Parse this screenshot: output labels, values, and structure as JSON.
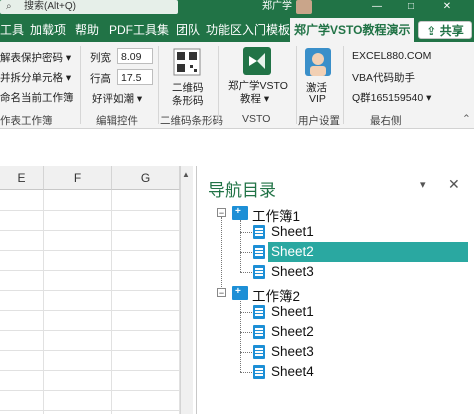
{
  "titlebar": {
    "search_text": "搜索(Alt+Q)",
    "user_name": "郑广学",
    "minimize": "—",
    "restore": "□",
    "close": "✕"
  },
  "tabs": [
    {
      "label": "工具"
    },
    {
      "label": "加载项"
    },
    {
      "label": "帮助"
    },
    {
      "label": "PDF工具集"
    },
    {
      "label": "团队"
    },
    {
      "label": "功能区入门模板"
    },
    {
      "label": "郑广学VSTO教程演示",
      "active": true
    }
  ],
  "share_label": "共享",
  "ribbon": {
    "workbook_tools": {
      "items": [
        "解表保护密码",
        "并拆分单元格",
        "命名当前工作簿"
      ],
      "group_label": "作表工作簿"
    },
    "edit_controls": {
      "col_width_label": "列宽",
      "col_width_value": "8.09",
      "row_height_label": "行高",
      "row_height_value": "17.5",
      "dropdown_label": "好评如潮",
      "group_label": "编辑控件"
    },
    "qr": {
      "button_label_1": "二维码",
      "button_label_2": "条形码",
      "group_label": "二维码条形码"
    },
    "vsto": {
      "button_label_1": "郑广学VSTO",
      "button_label_2": "教程",
      "group_label": "VSTO"
    },
    "user": {
      "button_label_1": "激活",
      "button_label_2": "VIP",
      "group_label": "用户设置"
    },
    "latest": {
      "items": [
        "EXCEL880.COM",
        "VBA代码助手",
        "Q群165159540"
      ],
      "group_label": "最右侧"
    }
  },
  "grid": {
    "columns": [
      "E",
      "F",
      "G"
    ]
  },
  "nav": {
    "title": "导航目录",
    "workbooks": [
      {
        "name": "工作簿1",
        "sheets": [
          "Sheet1",
          "Sheet2",
          "Sheet3"
        ]
      },
      {
        "name": "工作簿2",
        "sheets": [
          "Sheet1",
          "Sheet2",
          "Sheet3",
          "Sheet4"
        ]
      }
    ],
    "selected": "工作簿1/Sheet2"
  },
  "colors": {
    "brand": "#217346",
    "selection": "#2aa8a1",
    "tree_icon": "#1d8fd6"
  }
}
